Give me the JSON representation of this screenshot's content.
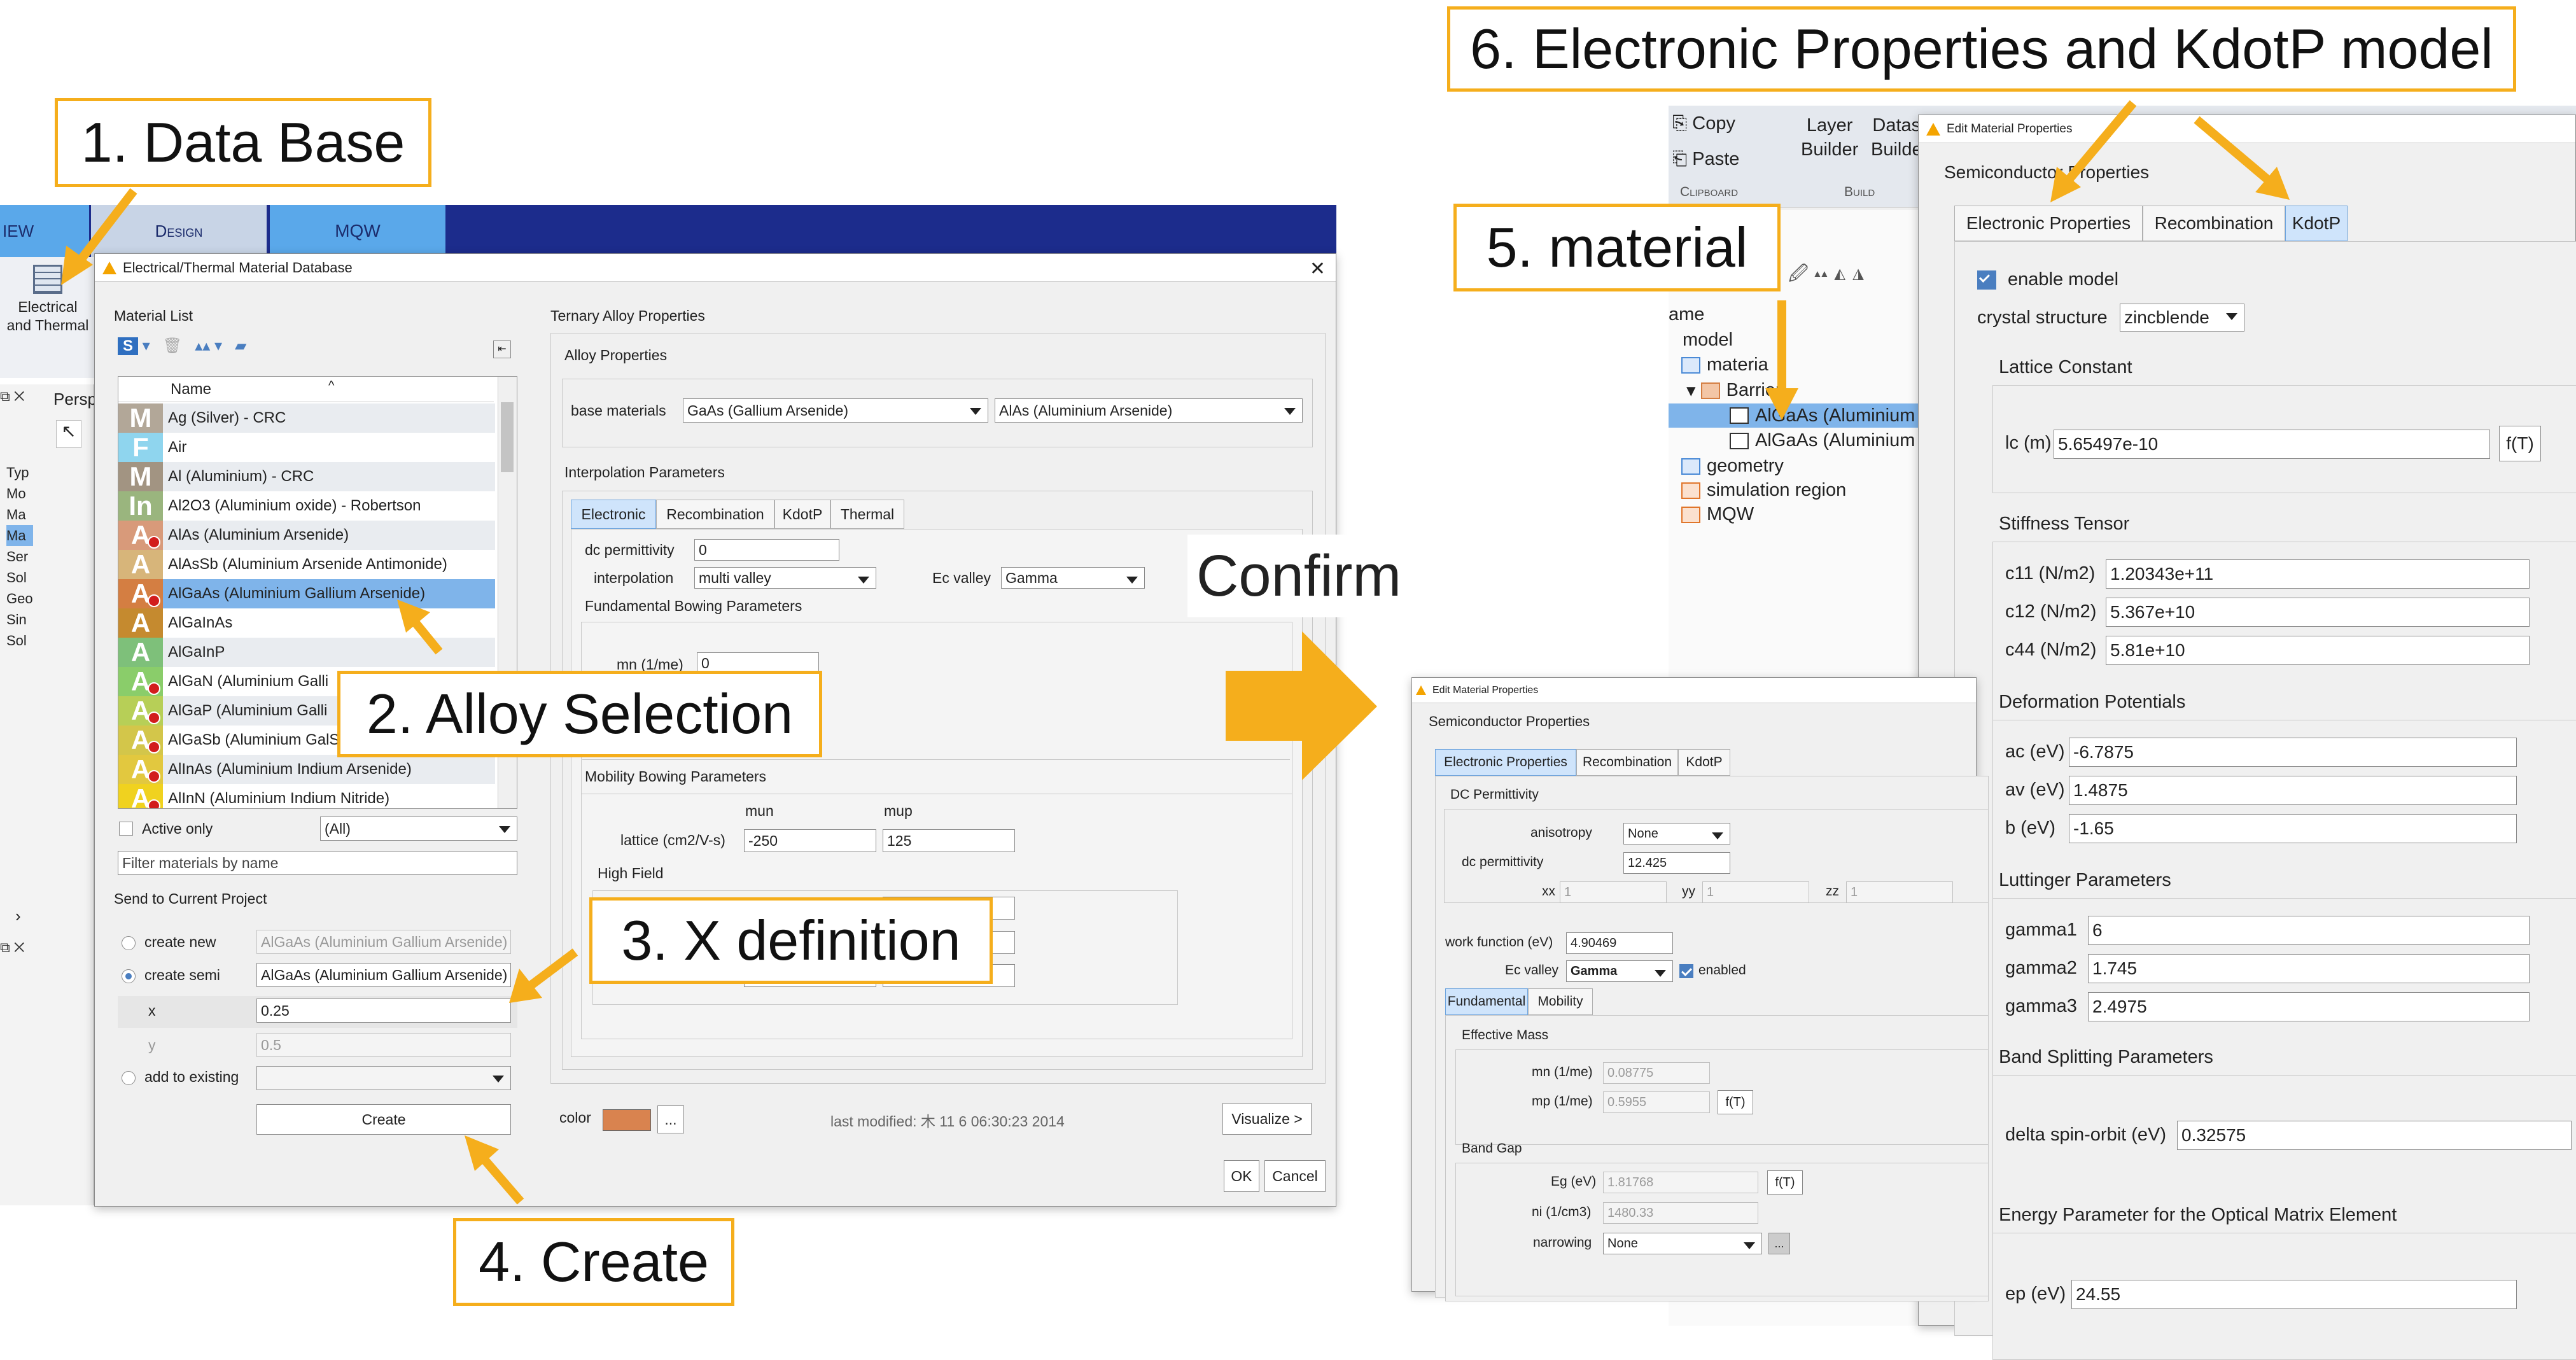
{
  "callouts": {
    "c1": "1. Data Base",
    "c2": "2. Alloy Selection",
    "c3": "3. X definition",
    "c4": "4. Create",
    "c5": "5. material",
    "c6": "6. Electronic Properties and KdotP model",
    "confirm": "Confirm"
  },
  "colors": {
    "callout_border": "#f5ae1c",
    "arrow": "#f5ae1c",
    "ribbon": "#1c2c8c",
    "selection": "#7fb4ea"
  },
  "ribbon": {
    "tab_view": "IEW",
    "tab_design": "Design",
    "tab_mqw": "MQW",
    "electrical_l1": "Electrical",
    "electrical_l2": "and Thermal",
    "persp": "Persp",
    "left_items": [
      "Typ",
      "Mo",
      "Ma",
      "Ma",
      "Ser",
      "Sol",
      "Geo",
      "Sin",
      "Sol"
    ]
  },
  "db": {
    "title": "Electrical/Thermal Material Database",
    "material_list_label": "Material List",
    "col_name": "Name",
    "materials": [
      {
        "name": "Ag (Silver) - CRC",
        "letter": "M",
        "color": "#b2a798"
      },
      {
        "name": "Air",
        "letter": "F",
        "color": "#8fd5ee"
      },
      {
        "name": "Al (Aluminium) - CRC",
        "letter": "M",
        "color": "#a29482"
      },
      {
        "name": "Al2O3 (Aluminium oxide) - Robertson",
        "letter": "In",
        "color": "#9ab57e"
      },
      {
        "name": "AlAs (Aluminium Arsenide)",
        "letter": "A",
        "color": "#d89a7a"
      },
      {
        "name": "AlAsSb (Aluminium Arsenide Antimonide)",
        "letter": "A",
        "color": "#d7b57a"
      },
      {
        "name": "AlGaAs (Aluminium Gallium Arsenide)",
        "letter": "A",
        "color": "#d47e42"
      },
      {
        "name": "AlGaInAs",
        "letter": "A",
        "color": "#c58a2f"
      },
      {
        "name": "AlGaInP",
        "letter": "A",
        "color": "#7ec07a"
      },
      {
        "name": "AlGaN (Aluminium Galli",
        "letter": "A",
        "color": "#8acd6a"
      },
      {
        "name": "AlGaP (Aluminium Galli",
        "letter": "A",
        "color": "#b7cf57"
      },
      {
        "name": "AlGaSb (Aluminium GalSb",
        "letter": "A",
        "color": "#d3c64a"
      },
      {
        "name": "AlInAs (Aluminium Indium Arsenide)",
        "letter": "A",
        "color": "#e2c83f"
      },
      {
        "name": "AlInN (Aluminium Indium Nitride)",
        "letter": "A",
        "color": "#f0d21f"
      }
    ],
    "active_only": "Active only",
    "filter_value": "(All)",
    "filter_placeholder": "Filter materials by name",
    "send_label": "Send to Current Project",
    "create_new": "create new",
    "create_new_val": "AlGaAs (Aluminium Gallium Arsenide)",
    "create_semi": "create semi",
    "create_semi_val": "AlGaAs (Aluminium Gallium Arsenide)",
    "x_label": "x",
    "x_val": "0.25",
    "y_label": "y",
    "y_val": "0.5",
    "add_existing": "add to existing",
    "create_btn": "Create",
    "ternary_label": "Ternary Alloy Properties",
    "alloy_props": "Alloy Properties",
    "base_materials": "base materials",
    "base1": "GaAs (Gallium Arsenide)",
    "base2": "AlAs (Aluminium Arsenide)",
    "interp_label": "Interpolation Parameters",
    "tabs": [
      "Electronic",
      "Recombination",
      "KdotP",
      "Thermal"
    ],
    "dc_perm": "dc permittivity",
    "dc_perm_val": "0",
    "interpolation": "interpolation",
    "interpolation_val": "multi valley",
    "ec_valley": "Ec valley",
    "ec_valley_val": "Gamma",
    "fund_bowing": "Fundamental Bowing Parameters",
    "mn_label": "mn (1/me)",
    "mn_val": "0",
    "mob_bowing": "Mobility Bowing Parameters",
    "mun": "mun",
    "mup": "mup",
    "lattice": "lattice (cm2/V-s)",
    "lattice_mun": "-250",
    "lattice_mup": "125",
    "high_field": "High Field",
    "color_label": "color",
    "color_value": "#d9834f",
    "ellipsis": "...",
    "last_modified": "last modified: 木 11 6 06:30:23 2014",
    "visualize": "Visualize >",
    "ok": "OK",
    "cancel": "Cancel"
  },
  "emp": {
    "title": "Edit Material Properties",
    "semi_props": "Semiconductor Properties",
    "tabs": [
      "Electronic Properties",
      "Recombination",
      "KdotP"
    ],
    "dc_perm_label": "DC Permittivity",
    "anisotropy": "anisotropy",
    "anisotropy_val": "None",
    "dc_perm": "dc permittivity",
    "dc_perm_val": "12.425",
    "xx": "xx",
    "yy": "yy",
    "zz": "zz",
    "xx_val": "1",
    "yy_val": "1",
    "zz_val": "1",
    "work_fn": "work function (eV)",
    "work_fn_val": "4.90469",
    "ec_valley": "Ec valley",
    "ec_valley_val": "Gamma",
    "enabled": "enabled",
    "subtabs": [
      "Fundamental",
      "Mobility"
    ],
    "eff_mass": "Effective Mass",
    "mn": "mn (1/me)",
    "mn_val": "0.08775",
    "mp": "mp (1/me)",
    "mp_val": "0.5955",
    "ft": "f(T)",
    "band_gap": "Band Gap",
    "eg": "Eg (eV)",
    "eg_val": "1.81768",
    "ni": "ni (1/cm3)",
    "ni_val": "1480.33",
    "narrowing": "narrowing",
    "narrowing_val": "None",
    "dots": "..."
  },
  "rp": {
    "copy": "Copy",
    "paste": "Paste",
    "clipboard": "Clipboard",
    "layer_builder_1": "Layer",
    "layer_builder_2": "Builder",
    "data_builder_1": "Datas",
    "data_builder_2": "Builde",
    "build": "Build",
    "dialog_title": "Edit Material Properties",
    "semi_props": "Semiconductor Properties",
    "tabs": [
      "Electronic Properties",
      "Recombination",
      "KdotP"
    ],
    "tree_name": "ame",
    "tree": {
      "model": "model",
      "materials": "materia",
      "barrier": "Barrier",
      "item1": "AlGaAs (Aluminium",
      "item2": "AlGaAs (Aluminium",
      "geometry": "geometry",
      "sim_region": "simulation region",
      "mqw": "MQW"
    },
    "enable_model": "enable model",
    "crystal": "crystal structure",
    "crystal_val": "zincblende",
    "lattice_const": "Lattice Constant",
    "lc": "lc (m)",
    "lc_val": "5.65497e-10",
    "ft": "f(T)",
    "stiffness": "Stiffness Tensor",
    "c11": "c11 (N/m2)",
    "c11_val": "1.20343e+11",
    "c12": "c12 (N/m2)",
    "c12_val": "5.367e+10",
    "c44": "c44 (N/m2)",
    "c44_val": "5.81e+10",
    "deformation": "Deformation Potentials",
    "ac": "ac (eV)",
    "ac_val": "-6.7875",
    "av": "av (eV)",
    "av_val": "1.4875",
    "b": "b (eV)",
    "b_val": "-1.65",
    "luttinger": "Luttinger Parameters",
    "g1": "gamma1",
    "g1_val": "6",
    "g2": "gamma2",
    "g2_val": "1.745",
    "g3": "gamma3",
    "g3_val": "2.4975",
    "band_split": "Band Splitting Parameters",
    "delta": "delta spin-orbit (eV)",
    "delta_val": "0.32575",
    "energy_param": "Energy Parameter for the Optical Matrix Element",
    "ep": "ep (eV)",
    "ep_val": "24.55"
  }
}
